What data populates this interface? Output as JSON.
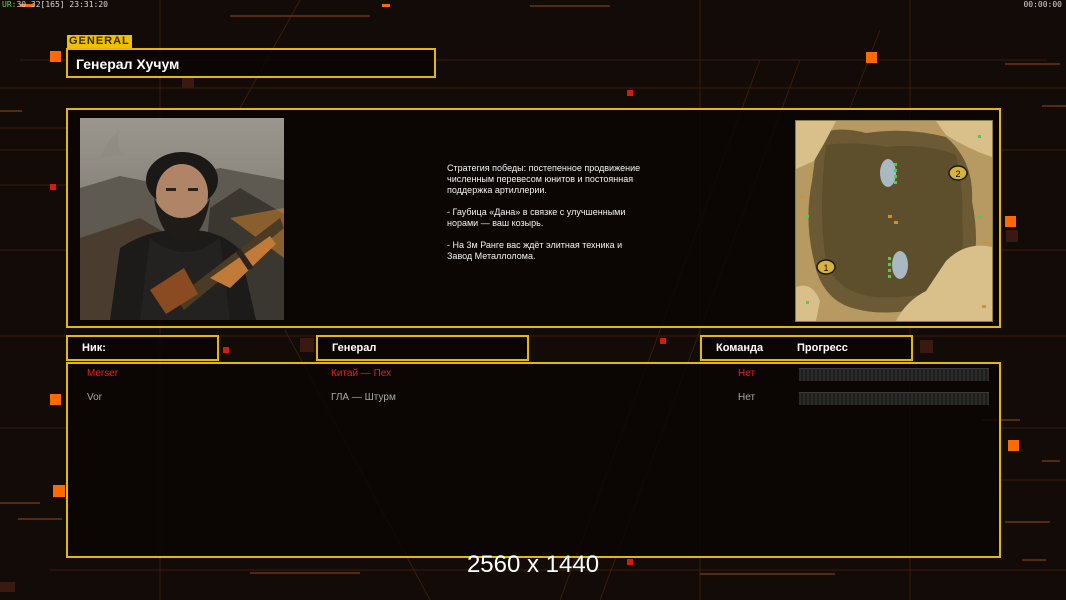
{
  "status_bar": {
    "left_prefix": "UR:",
    "left_rest": "30 32[165] 23:31:20",
    "right": "00:00:00"
  },
  "header": {
    "tag": "GENERAL",
    "title": "Генерал Хучум"
  },
  "briefing": {
    "paragraphs": [
      "Стратегия победы: постепенное продвижение численным перевесом юнитов и постоянная поддержка артиллерии.",
      "- Гаубица «Дана» в связке с улучшенными норами — ваш козырь.",
      "- На 3м Ранге вас ждёт элитная техника и Завод Металлолома."
    ]
  },
  "minimap": {
    "start_1": "1",
    "start_2": "2"
  },
  "columns": {
    "nick": "Ник:",
    "general": "Генерал",
    "team": "Команда",
    "progress": "Прогресс"
  },
  "players": [
    {
      "nick": "Merser",
      "general": "Китай — Пех",
      "team": "Нет",
      "color": "#e8201a"
    },
    {
      "nick": "Vor",
      "general": "ГЛА — Штурм",
      "team": "Нет",
      "color": "#a8a8a8"
    }
  ],
  "watermark": "2560 x 1440",
  "colors": {
    "frame_gold": "#e2b80f",
    "accent_orange": "#ff6a00",
    "background": "#120b08"
  }
}
